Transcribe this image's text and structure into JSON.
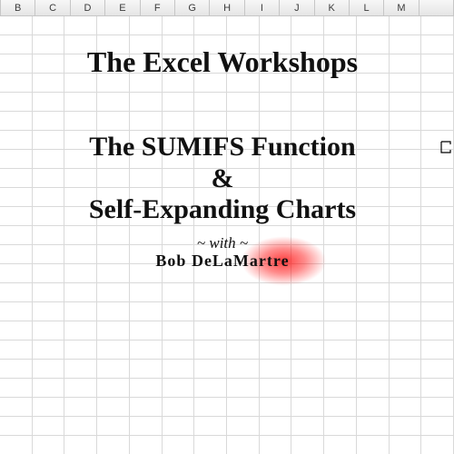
{
  "columns": [
    "B",
    "C",
    "D",
    "E",
    "F",
    "G",
    "H",
    "I",
    "J",
    "K",
    "L",
    "M"
  ],
  "row_count": 23,
  "title": {
    "line1": "The Excel Workshops",
    "line2": "The SUMIFS Function",
    "amp": "&",
    "line3": "Self-Expanding Charts",
    "with_text": "~ with ~",
    "author": "Bob DeLaMartre"
  }
}
